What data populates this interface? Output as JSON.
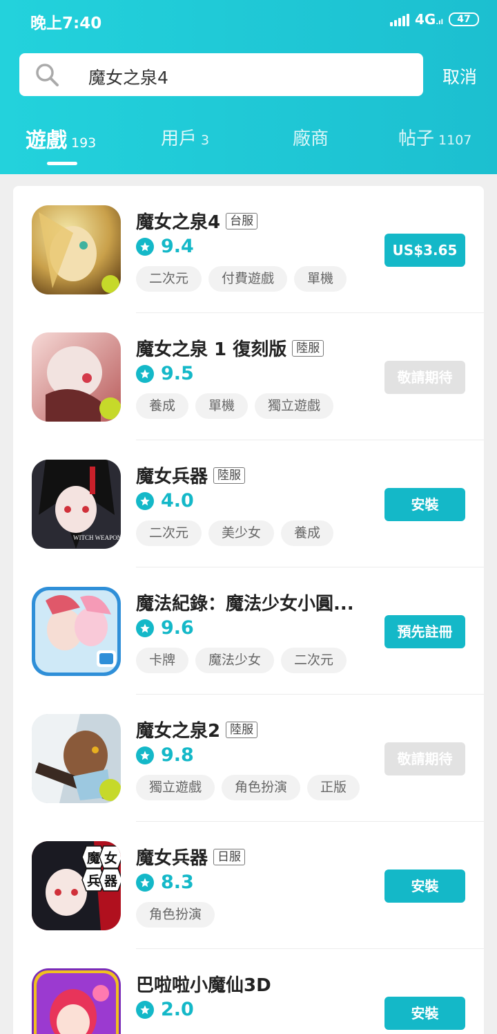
{
  "status_bar": {
    "time": "晚上7:40",
    "network": "4G",
    "battery": "47"
  },
  "search": {
    "query": "魔女之泉4",
    "cancel_label": "取消"
  },
  "tabs": [
    {
      "label": "遊戲",
      "count": "193",
      "active": true
    },
    {
      "label": "用戶",
      "count": "3"
    },
    {
      "label": "廠商",
      "count": ""
    },
    {
      "label": "帖子",
      "count": "1107"
    }
  ],
  "colors": {
    "accent": "#14b8c8",
    "header_start": "#23d2dc",
    "header_end": "#1cbfd0",
    "button_disabled": "#e2e2e2"
  },
  "results": [
    {
      "name": "魔女之泉4",
      "region": "台服",
      "rating": "9.4",
      "tags": [
        "二次元",
        "付費遊戲",
        "單機"
      ],
      "action": "US$3.65",
      "enabled": true,
      "icon": "witch-spring-4-icon"
    },
    {
      "name": "魔女之泉 1 復刻版",
      "region": "陸服",
      "rating": "9.5",
      "tags": [
        "養成",
        "單機",
        "獨立遊戲"
      ],
      "action": "敬請期待",
      "enabled": false,
      "icon": "witch-spring-1-icon"
    },
    {
      "name": "魔女兵器",
      "region": "陸服",
      "rating": "4.0",
      "tags": [
        "二次元",
        "美少女",
        "養成"
      ],
      "action": "安裝",
      "enabled": true,
      "icon": "witch-weapon-icon",
      "icon_text": "WITCH WEAPON"
    },
    {
      "name": "魔法紀錄：魔法少女小圓...",
      "region": "",
      "rating": "9.6",
      "tags": [
        "卡牌",
        "魔法少女",
        "二次元"
      ],
      "action": "預先註冊",
      "enabled": true,
      "icon": "magia-record-icon"
    },
    {
      "name": "魔女之泉2",
      "region": "陸服",
      "rating": "9.8",
      "tags": [
        "獨立遊戲",
        "角色扮演",
        "正版"
      ],
      "action": "敬請期待",
      "enabled": false,
      "icon": "witch-spring-2-icon"
    },
    {
      "name": "魔女兵器",
      "region": "日服",
      "rating": "8.3",
      "tags": [
        "角色扮演"
      ],
      "action": "安裝",
      "enabled": true,
      "icon": "witch-weapon-jp-icon",
      "icon_text": [
        "魔",
        "女",
        "兵",
        "器"
      ]
    },
    {
      "name": "巴啦啦小魔仙3D",
      "region": "",
      "rating": "2.0",
      "tags": [],
      "action": "安裝",
      "enabled": true,
      "icon": "balala-icon"
    }
  ]
}
